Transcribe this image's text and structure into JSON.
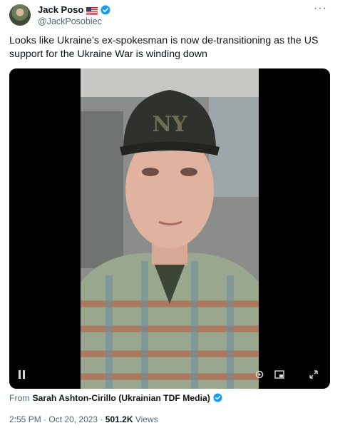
{
  "author": {
    "display_name": "Jack Poso",
    "handle": "@JackPosobiec",
    "flag_icon": "us-flag-icon",
    "verified_icon": "verified-badge-icon",
    "verified_color": "#1d9bf0"
  },
  "more_label": "···",
  "tweet": {
    "text": "Looks like Ukraine’s ex-spokesman is now de-transitioning as the US support for the Ukraine War is winding down"
  },
  "media": {
    "type": "video",
    "cap_logo": "NY",
    "controls": {
      "pause_icon": "pause-icon",
      "settings_icon": "gear-icon",
      "pip_icon": "picture-in-picture-icon",
      "fullscreen_icon": "expand-icon"
    }
  },
  "attribution": {
    "prefix": "From",
    "source": "Sarah Ashton-Cirillo (Ukrainian TDF Media)"
  },
  "meta": {
    "time": "2:55 PM",
    "separator": "·",
    "date": "Oct 20, 2023",
    "views_count": "501.2K",
    "views_label": "Views"
  },
  "colors": {
    "text_primary": "#0f1419",
    "text_secondary": "#536471",
    "accent": "#1d9bf0"
  }
}
